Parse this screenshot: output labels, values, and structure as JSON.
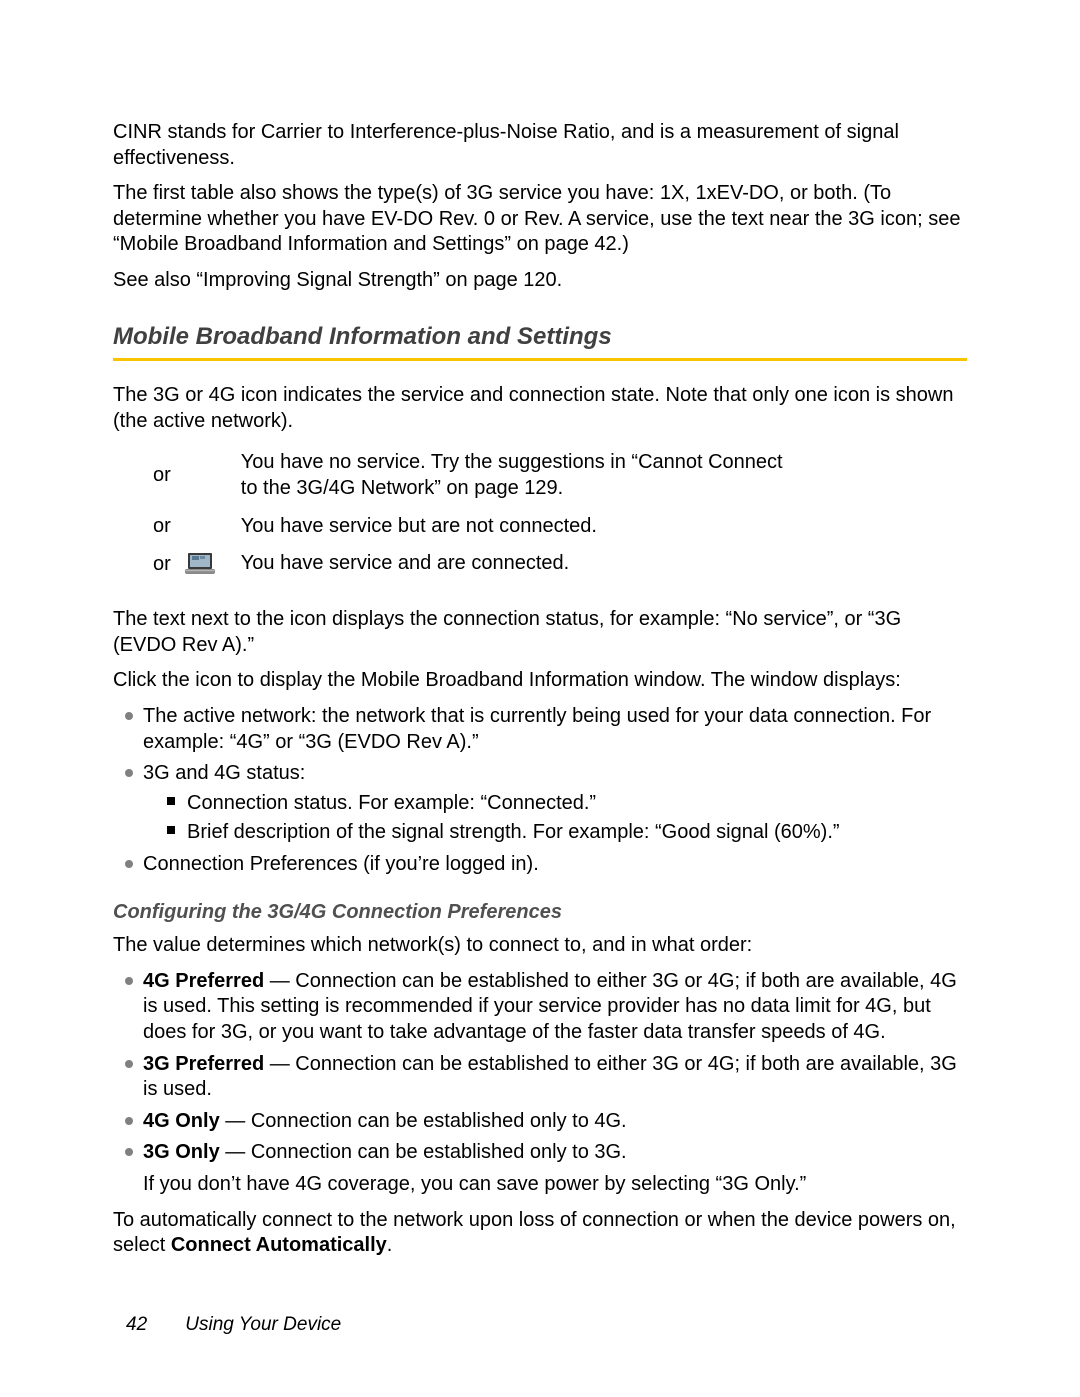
{
  "intro": {
    "p1": "CINR stands for Carrier to Interference-plus-Noise Ratio, and is a measurement of signal effectiveness.",
    "p2": "The first table also shows the type(s) of 3G service you have: 1X, 1xEV-DO, or both. (To determine whether you have EV-DO Rev. 0 or Rev. A service, use the text near the 3G icon; see “Mobile Broadband Information and Settings” on page 42.)",
    "p3": "See also “Improving Signal Strength” on page 120."
  },
  "heading": "Mobile Broadband Information and Settings",
  "after_heading": "The 3G or 4G icon indicates the service and connection state. Note that only one icon is shown (the active network).",
  "table": {
    "or": "or",
    "r1": "You have no service. Try the suggestions in “Cannot Connect to the 3G/4G Network” on page 129.",
    "r2": "You have service but are not connected.",
    "r3": "You have service and are connected."
  },
  "body": {
    "p1": "The text next to the icon displays the connection status, for example: “No service”, or “3G (EVDO Rev A).”",
    "p2": "Click the icon to display the Mobile Broadband Information window. The window displays:",
    "b1": "The active network: the network that is currently being used for your data connection. For example: “4G” or “3G (EVDO Rev A).”",
    "b2": "3G and 4G status:",
    "s1": "Connection status. For example: “Connected.”",
    "s2": "Brief description of the signal strength. For example: “Good signal (60%).”",
    "b3": "Connection Preferences (if you’re logged in)."
  },
  "sub": {
    "title": "Configuring the 3G/4G Connection Preferences",
    "intro": "The value determines which network(s) to connect to, and in what order:",
    "opt1b": "4G Preferred",
    "opt1": " — Connection can be established to either 3G or 4G; if both are available, 4G is used. This setting is recommended if your service provider has no data limit for 4G, but does for 3G, or you want to take advantage of the faster data transfer speeds of 4G.",
    "opt2b": "3G Preferred",
    "opt2": " — Connection can be established to either 3G or 4G; if both are available, 3G is used.",
    "opt3b": "4G Only",
    "opt3": " — Connection can be established only to 4G.",
    "opt4b": "3G Only",
    "opt4": " — Connection can be established only to 3G.",
    "note": "If you don’t have 4G coverage, you can save power by selecting “3G Only.”",
    "closing_a": "To automatically connect to the network upon loss of connection or when the device powers on, select ",
    "closing_b": "Connect Automatically",
    "closing_c": "."
  },
  "footer": {
    "page": "42",
    "section": "Using Your Device"
  }
}
